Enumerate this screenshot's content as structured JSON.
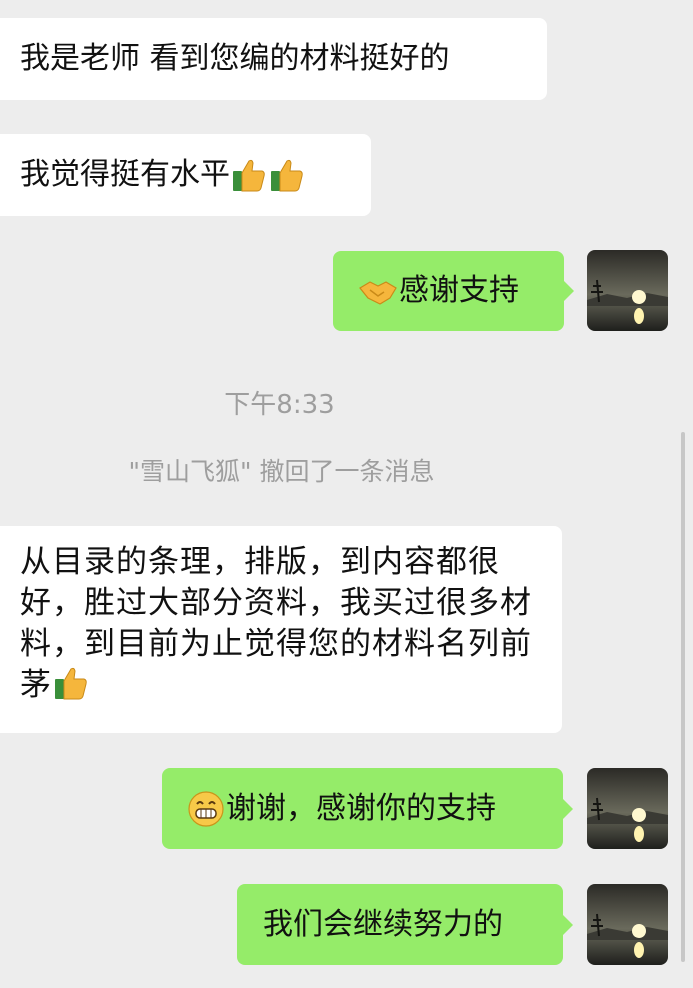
{
  "messages": [
    {
      "side": "left",
      "text": "我是老师 看到您编的材料挺好的"
    },
    {
      "side": "left",
      "text": "我觉得挺有水平",
      "emojis": [
        "thumbs-up",
        "thumbs-up"
      ]
    },
    {
      "side": "right",
      "prefix_emoji": "handshake",
      "text": "感谢支持"
    },
    {
      "side": "left",
      "text": "从目录的条理，排版，到内容都很好，胜过大部分资料，我买过很多材料，到目前为止觉得您的材料名列前茅",
      "emojis": [
        "thumbs-up"
      ]
    },
    {
      "side": "right",
      "prefix_emoji": "grin",
      "text": "谢谢，感谢你的支持"
    },
    {
      "side": "right",
      "text": "我们会继续努力的"
    }
  ],
  "time_divider": "下午8:33",
  "recall_notice": "\"雪山飞狐\" 撤回了一条消息",
  "colors": {
    "background": "#ededed",
    "left_bubble": "#ffffff",
    "right_bubble": "#95ec69",
    "meta_text": "#9e9e9e"
  }
}
